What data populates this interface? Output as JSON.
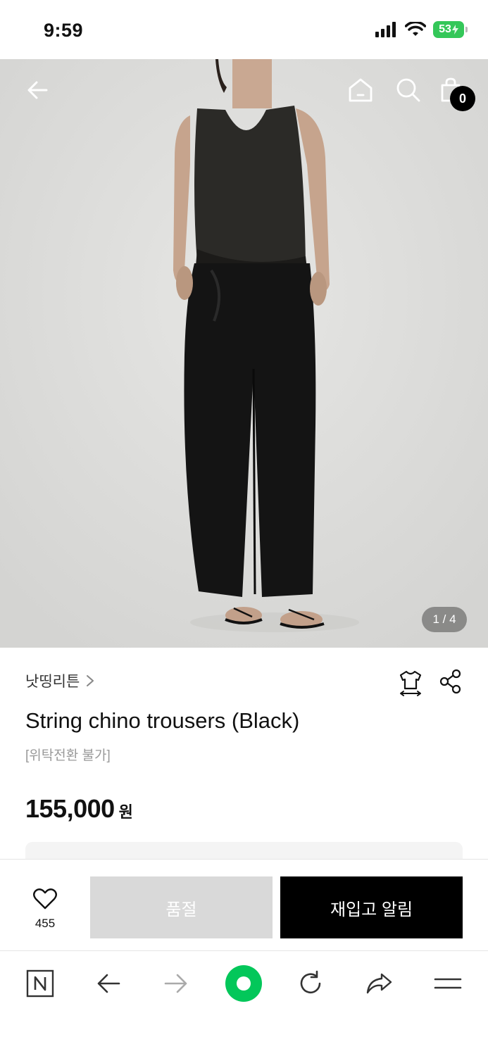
{
  "status_bar": {
    "time": "9:59",
    "battery": "53"
  },
  "hero": {
    "page_indicator": "1 / 4"
  },
  "header": {
    "cart_count": "0"
  },
  "product": {
    "brand": "낫띵리튼",
    "title": "String chino trousers (Black)",
    "note": "[위탁전환 불가]",
    "price": "155,000",
    "currency": "원"
  },
  "actions": {
    "wish_count": "455",
    "soldout_label": "품절",
    "restock_label": "재입고 알림"
  },
  "colors": {
    "primary_button": "#000000",
    "disabled_button": "#d9d9d9",
    "browser_accent": "#03c75a"
  },
  "browser_bar": {
    "icons": [
      "naver-n-icon",
      "back-arrow-icon",
      "forward-arrow-icon",
      "green-dot-icon",
      "refresh-icon",
      "share-arrow-icon",
      "menu-icon"
    ]
  }
}
